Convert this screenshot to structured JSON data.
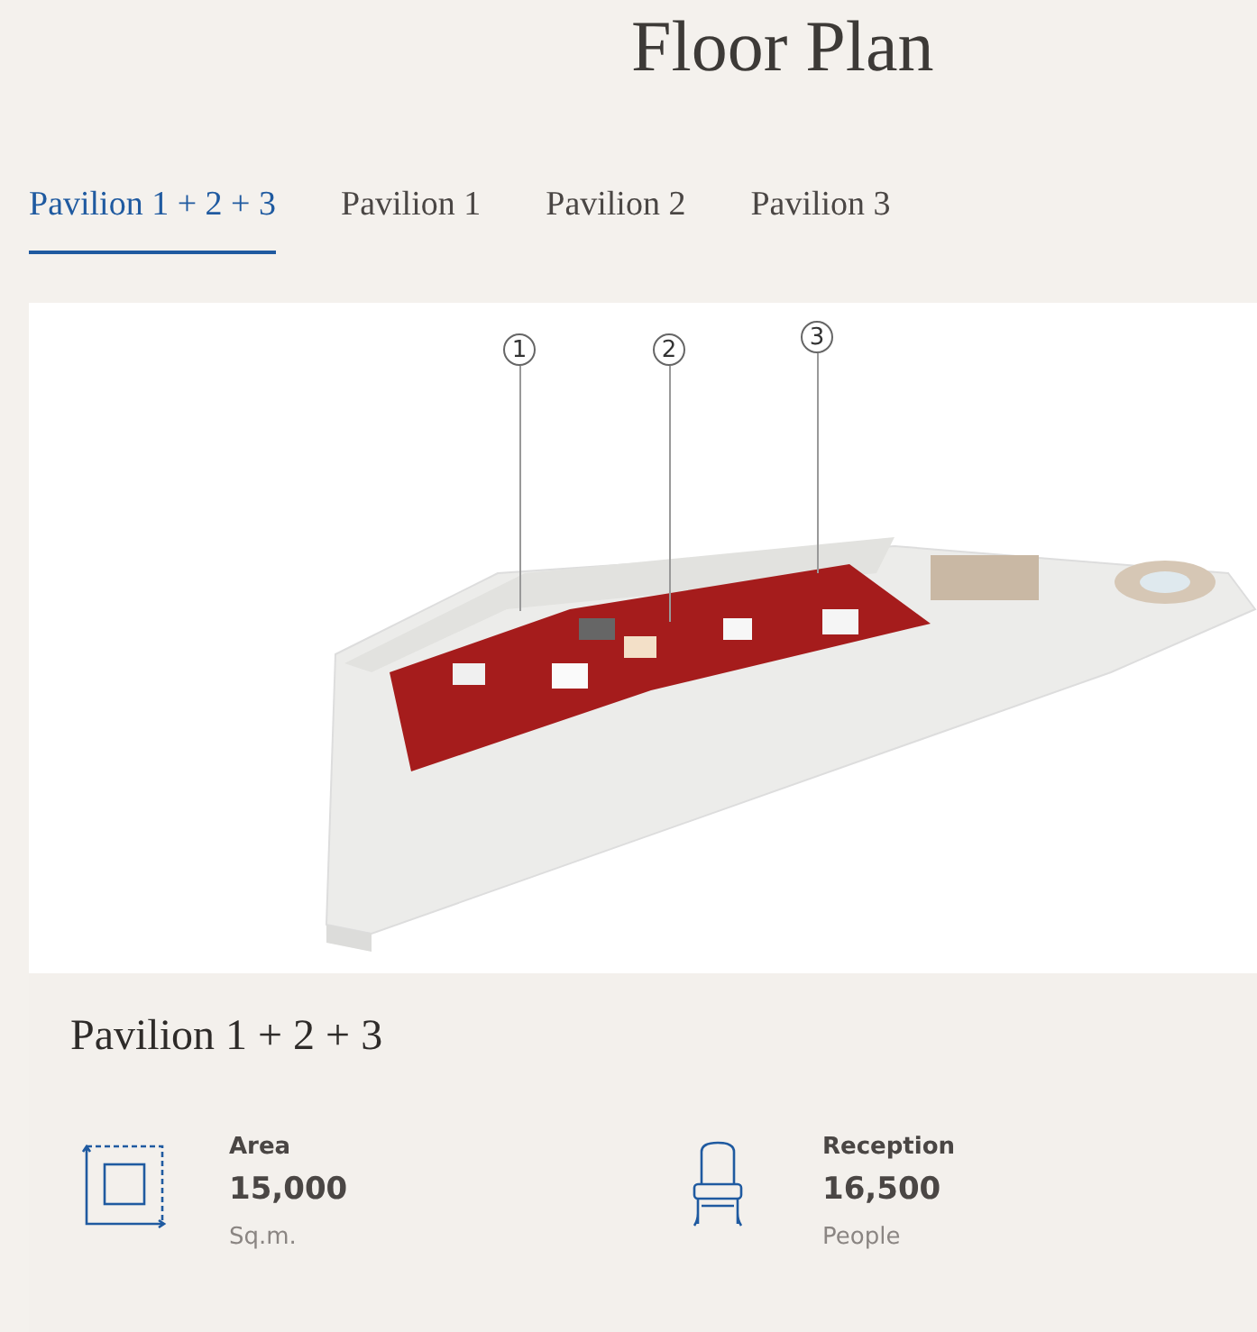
{
  "title": "Floor Plan",
  "tabs": [
    {
      "label": "Pavilion 1 + 2 + 3",
      "selected": true
    },
    {
      "label": "Pavilion 1",
      "selected": false
    },
    {
      "label": "Pavilion 2",
      "selected": false
    },
    {
      "label": "Pavilion 3",
      "selected": false
    }
  ],
  "plan": {
    "kind": "picture",
    "markers": [
      "1",
      "2",
      "3"
    ]
  },
  "details": {
    "heading": "Pavilion 1 + 2 + 3",
    "stats": [
      {
        "kind": "area",
        "label": "Area",
        "value": "15,000",
        "unit": "Sq.m."
      },
      {
        "kind": "reception",
        "label": "Reception",
        "value": "16,500",
        "unit": "People"
      }
    ]
  }
}
